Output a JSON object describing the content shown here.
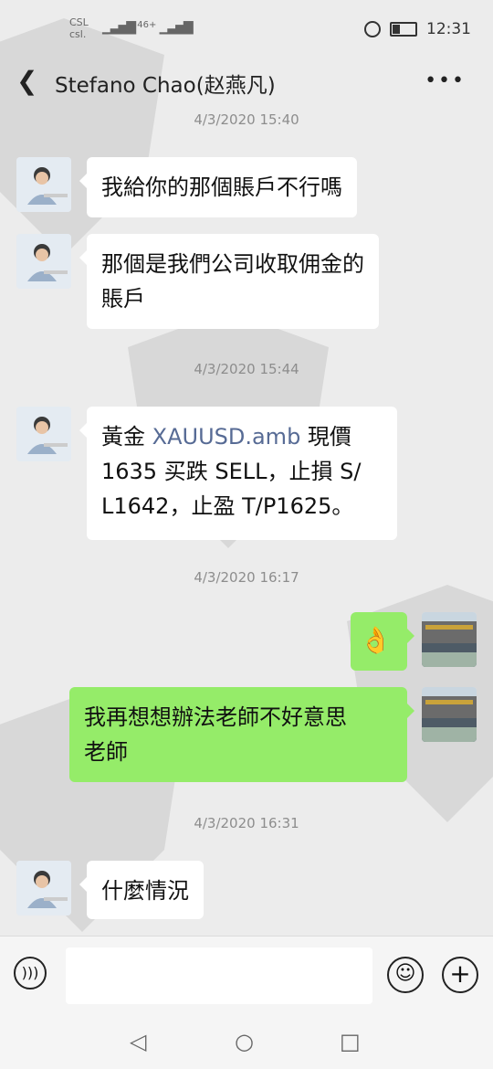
{
  "statusbar": {
    "carrier_top": "CSL",
    "carrier_bottom": "csl.",
    "signal": "46+",
    "time": "12:31"
  },
  "header": {
    "title": "Stefano Chao(赵燕凡)"
  },
  "messages": {
    "ts1": "4/3/2020 15:40",
    "m1": "我給你的那個賬戶不行嗎",
    "m2a": "那個是我們公司收取佣金的",
    "m2b": "賬戶",
    "ts2": "4/3/2020 15:44",
    "m3_pre": "黃金 ",
    "m3_link": "XAUUSD.amb",
    "m3_post": " 現價",
    "m3b": "1635 买跌 SELL，止損 S/",
    "m3c": "L1642，止盈 T/P1625。",
    "ts3": "4/3/2020 16:17",
    "m4_emoji": "👌",
    "m5a": "我再想想辦法老師不好意思",
    "m5b": "老師",
    "ts4": "4/3/2020 16:31",
    "m6": "什麼情況"
  },
  "inputbar": {
    "voice_icon": "voice-icon",
    "emoji_icon": "emoji-icon",
    "plus_icon": "plus-icon"
  }
}
